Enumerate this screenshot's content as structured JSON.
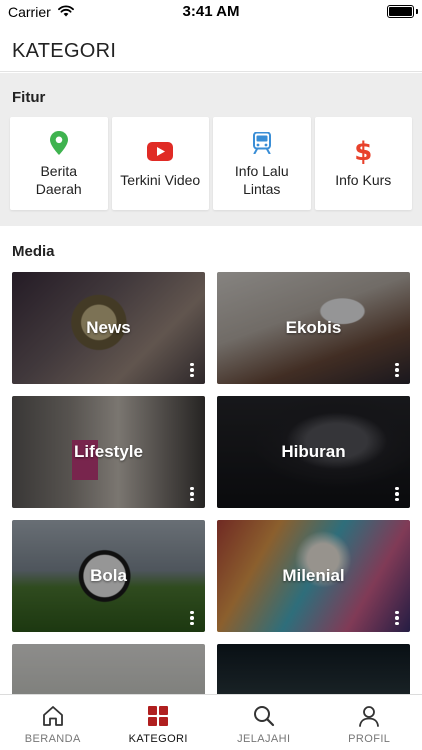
{
  "status_bar": {
    "carrier": "Carrier",
    "time": "3:41 AM"
  },
  "header": {
    "title": "KATEGORI"
  },
  "fitur": {
    "title": "Fitur",
    "items": [
      {
        "label": "Berita Daerah",
        "icon": "map-pin-icon",
        "color": "#3fb34f"
      },
      {
        "label": "Terkini Video",
        "icon": "youtube-icon",
        "color": "#e02b25"
      },
      {
        "label": "Info Lalu Lintas",
        "icon": "train-icon",
        "color": "#3a8ed6"
      },
      {
        "label": "Info Kurs",
        "icon": "dollar-icon",
        "color": "#e8412b"
      }
    ]
  },
  "media": {
    "title": "Media",
    "items": [
      {
        "label": "News"
      },
      {
        "label": "Ekobis"
      },
      {
        "label": "Lifestyle"
      },
      {
        "label": "Hiburan"
      },
      {
        "label": "Bola"
      },
      {
        "label": "Milenial"
      },
      {
        "label": ""
      },
      {
        "label": ""
      }
    ]
  },
  "nav": {
    "active": "KATEGORI",
    "items": [
      {
        "label": "BERANDA",
        "icon": "home-icon"
      },
      {
        "label": "KATEGORI",
        "icon": "grid-icon",
        "active_color": "#b01f1f"
      },
      {
        "label": "JELAJAHI",
        "icon": "search-icon"
      },
      {
        "label": "PROFIL",
        "icon": "person-icon"
      }
    ]
  }
}
